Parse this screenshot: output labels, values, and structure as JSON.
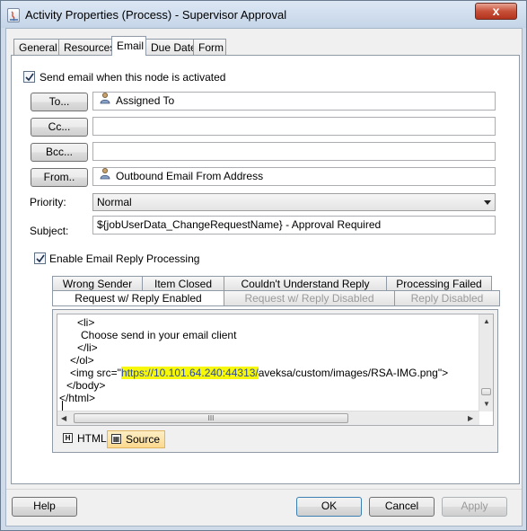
{
  "window": {
    "title": "Activity Properties (Process) - Supervisor Approval",
    "close_glyph": "x"
  },
  "tabs": [
    {
      "label": "General"
    },
    {
      "label": "Resources"
    },
    {
      "label": "Email"
    },
    {
      "label": "Due Date"
    },
    {
      "label": "Form"
    }
  ],
  "active_tab": "Email",
  "email": {
    "send_email_checkbox": {
      "label": "Send email when this node is activated",
      "checked": true
    },
    "to": {
      "button": "To...",
      "value": "Assigned To",
      "icon": "person-icon"
    },
    "cc": {
      "button": "Cc...",
      "value": ""
    },
    "bcc": {
      "button": "Bcc...",
      "value": ""
    },
    "from": {
      "button": "From..",
      "value": "Outbound Email From Address",
      "icon": "person-icon"
    },
    "priority": {
      "label": "Priority:",
      "selected": "Normal"
    },
    "subject": {
      "label": "Subject:",
      "value": "${jobUserData_ChangeRequestName} - Approval Required"
    },
    "reply_checkbox": {
      "label": "Enable Email Reply Processing",
      "checked": true
    }
  },
  "reply_tabs": {
    "row1": [
      {
        "label": "Wrong Sender",
        "disabled": false
      },
      {
        "label": "Item Closed",
        "disabled": false
      },
      {
        "label": "Couldn't Understand Reply",
        "disabled": false
      },
      {
        "label": "Processing Failed",
        "disabled": false
      }
    ],
    "row2": [
      {
        "label": "Request w/ Reply Enabled",
        "disabled": false,
        "active": true
      },
      {
        "label": "Request w/ Reply Disabled",
        "disabled": true
      },
      {
        "label": "Reply Disabled",
        "disabled": true
      }
    ]
  },
  "editor": {
    "lines": [
      "<li>",
      "Choose send in your email client",
      "</li>",
      "</ol>",
      "<img src=\"",
      "https://10.101.64.240:44313/",
      "aveksa/custom/images/RSA-IMG.png\">",
      "</body>",
      "</html>"
    ],
    "hscroll_thumb_glyph": "III",
    "modes": [
      {
        "label": "HTML",
        "icon_glyph": "H",
        "active": false
      },
      {
        "label": "Source",
        "icon_glyph": "▦",
        "active": true
      }
    ]
  },
  "footer": {
    "help": "Help",
    "ok": "OK",
    "cancel": "Cancel",
    "apply": "Apply"
  },
  "colors": {
    "highlight": "#f7f70a",
    "highlight_text": "#2d4a9f",
    "disabled_text": "#9a9a9a"
  }
}
